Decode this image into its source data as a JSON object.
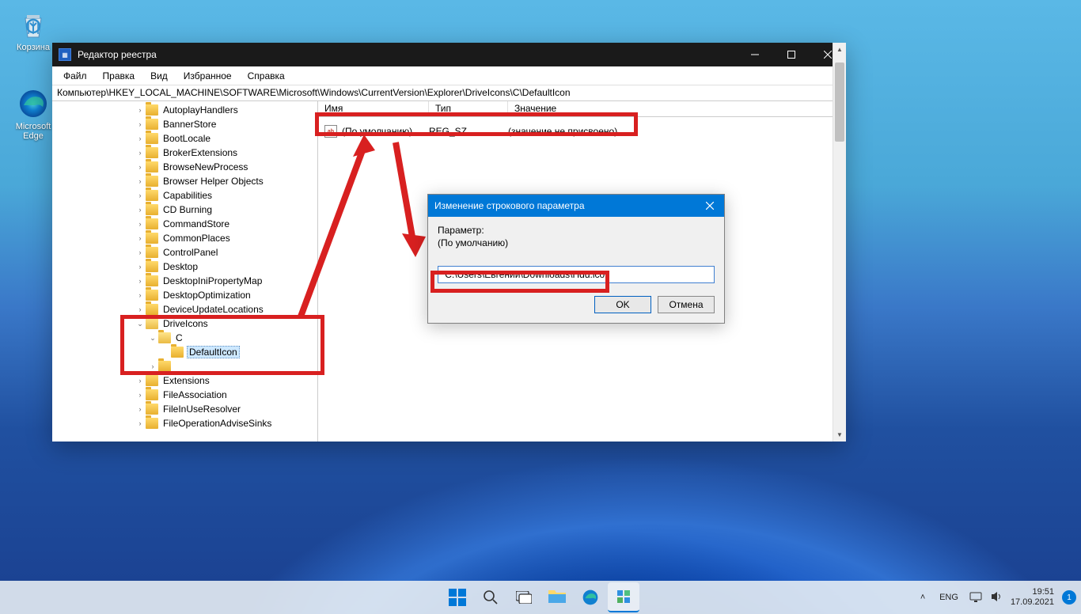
{
  "desktop": {
    "recycle_bin_label": "Корзина",
    "edge_label": "Microsoft Edge"
  },
  "regedit": {
    "title": "Редактор реестра",
    "menu": {
      "file": "Файл",
      "edit": "Правка",
      "view": "Вид",
      "favorites": "Избранное",
      "help": "Справка"
    },
    "path": "Компьютер\\HKEY_LOCAL_MACHINE\\SOFTWARE\\Microsoft\\Windows\\CurrentVersion\\Explorer\\DriveIcons\\C\\DefaultIcon",
    "tree": [
      "AutoplayHandlers",
      "BannerStore",
      "BootLocale",
      "BrokerExtensions",
      "BrowseNewProcess",
      "Browser Helper Objects",
      "Capabilities",
      "CD Burning",
      "CommandStore",
      "CommonPlaces",
      "ControlPanel",
      "Desktop",
      "DesktopIniPropertyMap",
      "DesktopOptimization",
      "DeviceUpdateLocations"
    ],
    "tree_drive": {
      "parent": "DriveIcons",
      "child": "C",
      "leaf": "DefaultIcon"
    },
    "tree_after": [
      "Extensions",
      "FileAssociation",
      "FileInUseResolver",
      "FileOperationAdviseSinks"
    ],
    "columns": {
      "name": "Имя",
      "type": "Тип",
      "value": "Значение"
    },
    "value_row": {
      "name": "(По умолчанию)",
      "type": "REG_SZ",
      "data": "(значение не присвоено)"
    }
  },
  "dialog": {
    "title": "Изменение строкового параметра",
    "param_label": "Параметр:",
    "param_name": "(По умолчанию)",
    "value_input": "\"C:\\Users\\Евгений\\Downloads\\Hdd.ico\"",
    "ok": "OK",
    "cancel": "Отмена"
  },
  "taskbar": {
    "lang": "ENG",
    "time": "19:51",
    "date": "17.09.2021",
    "notif_count": "1"
  }
}
